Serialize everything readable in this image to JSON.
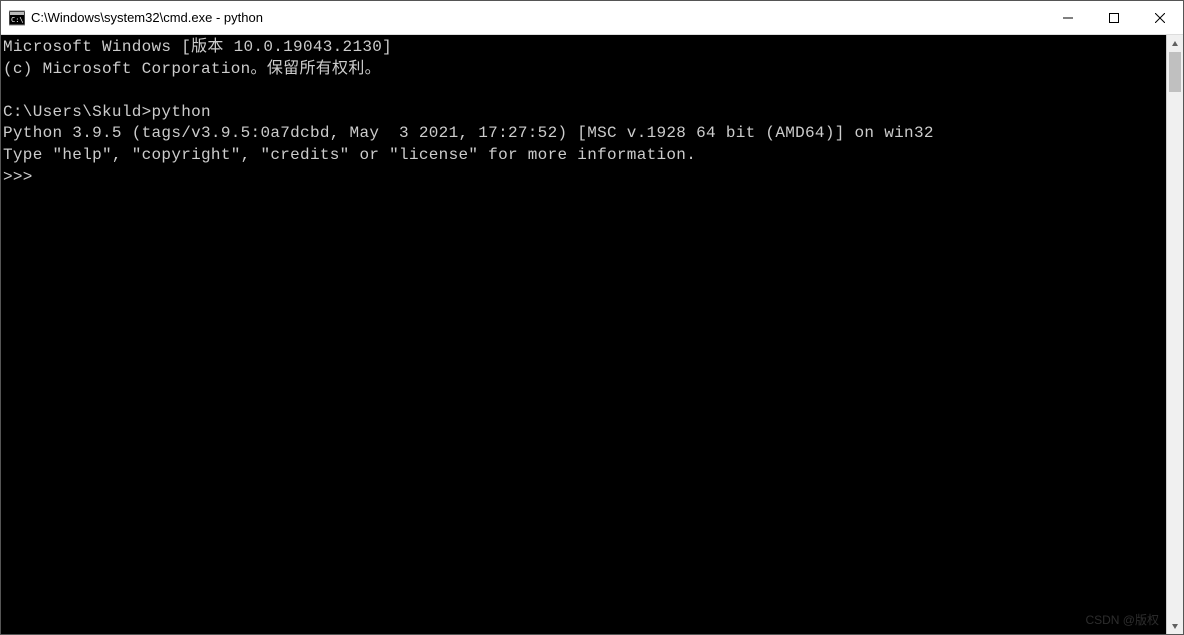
{
  "window": {
    "title": "C:\\Windows\\system32\\cmd.exe - python"
  },
  "terminal": {
    "lines": [
      "Microsoft Windows [版本 10.0.19043.2130]",
      "(c) Microsoft Corporation。保留所有权利。",
      "",
      "C:\\Users\\Skuld>python",
      "Python 3.9.5 (tags/v3.9.5:0a7dcbd, May  3 2021, 17:27:52) [MSC v.1928 64 bit (AMD64)] on win32",
      "Type \"help\", \"copyright\", \"credits\" or \"license\" for more information.",
      ">>>"
    ]
  },
  "watermark": "CSDN @版权"
}
